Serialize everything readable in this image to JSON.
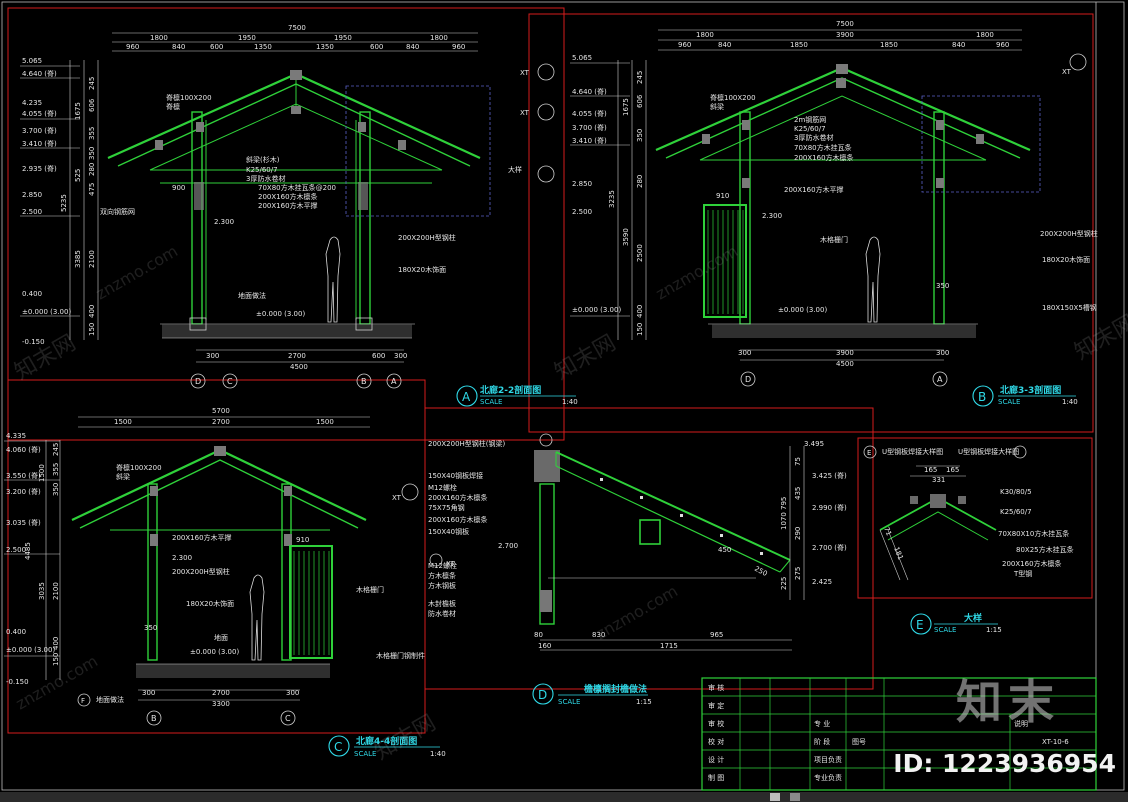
{
  "sections": {
    "a": {
      "letter": "A",
      "title": "北廊2-2剖面图",
      "scale_word": "SCALE",
      "scale": "1:40"
    },
    "b": {
      "letter": "B",
      "title": "北廊3-3剖面图",
      "scale_word": "SCALE",
      "scale": "1:40"
    },
    "c": {
      "letter": "C",
      "title": "北廊4-4剖面图",
      "scale_word": "SCALE",
      "scale": "1:40"
    },
    "d": {
      "letter": "D",
      "title": "檐檩搁封檐做法",
      "scale_word": "SCALE",
      "scale": "1:15"
    },
    "e": {
      "letter": "E",
      "title": "大样",
      "scale_word": "SCALE",
      "scale": "1:15"
    }
  },
  "a_dims": {
    "total": "7500",
    "top1": [
      "1800",
      "1950",
      "1950",
      "1800"
    ],
    "top2": [
      "960",
      "840",
      "600",
      "1350",
      "1350",
      "600",
      "840",
      "960"
    ],
    "bottom1": [
      "300",
      "2700",
      "600",
      "300"
    ],
    "bottom_total": "4500",
    "axes": [
      "D",
      "C",
      "B",
      "A"
    ],
    "elev": [
      "5.065",
      "4.640 (脊)",
      "4.235",
      "4.055 (脊)",
      "3.700 (脊)",
      "3.410 (脊)",
      "2.935 (脊)",
      "2.850",
      "2.500",
      "0.400",
      "±0.000 (3.00)",
      "-0.150"
    ],
    "left_dims": [
      "245",
      "606",
      "1675",
      "355",
      "350",
      "280",
      "475",
      "525",
      "3385",
      "2100",
      "400",
      "150",
      "5235"
    ],
    "notes": [
      "脊檩100X200",
      "脊檩",
      "斜梁(杉木)",
      "方木",
      "K25/60/7",
      "3厚防水卷材",
      "70X80方木挂瓦条@200",
      "200X160方木檩条",
      "200X160方木平撑",
      "双向钢筋网",
      "200X200H型钢柱",
      "180X20木饰面",
      "±0.000 (3.00)",
      "地面做法"
    ],
    "small": [
      "900",
      "2.300",
      "大样",
      "XT"
    ]
  },
  "b_dims": {
    "total": "7500",
    "top1": [
      "1800",
      "3900",
      "1800"
    ],
    "top2": [
      "960",
      "840",
      "1850",
      "1850",
      "840",
      "960"
    ],
    "bottom1": [
      "300",
      "3900",
      "300"
    ],
    "bottom_total": "4500",
    "axes": [
      "D",
      "A"
    ],
    "elev": [
      "5.065",
      "4.640 (脊)",
      "4.055 (脊)",
      "3.700 (脊)",
      "3.410 (脊)",
      "2.850",
      "2.500",
      "±0.000 (3.00)"
    ],
    "left_dims": [
      "245",
      "606",
      "1675",
      "350",
      "280",
      "3235",
      "3590",
      "2500",
      "400",
      "150"
    ],
    "notes": [
      "脊檩100X200",
      "斜梁",
      "2m钢筋网",
      "K25/60/7",
      "3厚防水卷材",
      "70X80方木挂瓦条",
      "200X160方木檩条",
      "200X160方木平撑",
      "200X200H型钢柱",
      "180X20木饰面",
      "木格栅门",
      "910",
      "2.300",
      "350",
      "180X150X5槽钢",
      "±0.000 (3.00)"
    ],
    "small": [
      "XT",
      "XT"
    ]
  },
  "c_dims": {
    "total": "5700",
    "top1": [
      "1500",
      "2700",
      "1500"
    ],
    "bottom1": [
      "300",
      "2700",
      "300"
    ],
    "bottom_total": "3300",
    "axes": [
      "B",
      "C"
    ],
    "elev": [
      "4.335",
      "4.060 (脊)",
      "3.550 (脊)",
      "3.200 (脊)",
      "3.035 (脊)",
      "2.500",
      "0.400",
      "±0.000 (3.00)",
      "-0.150"
    ],
    "left_dims": [
      "245",
      "355",
      "350",
      "1500",
      "4485",
      "3035",
      "2100",
      "400",
      "150"
    ],
    "notes": [
      "脊檩100X200",
      "斜梁",
      "200X160方木平撑",
      "2.300",
      "200X200H型钢柱",
      "180X20木饰面",
      "木格栅门",
      "910",
      "350",
      "地面",
      "±0.000 (3.00)",
      "木格栅门钢制件",
      "地面做法"
    ],
    "small": [
      "XT",
      "F"
    ]
  },
  "d_dims": {
    "notes": [
      "200X200H型钢柱(钢梁)",
      "150X40钢板焊接",
      "M12螺栓",
      "200X160方木檩条",
      "75X75角钢",
      "200X160方木檩条",
      "150X40钢板",
      "M12螺栓",
      "方木檩条",
      "方木钢板",
      "木封檐板",
      "防水卷材",
      "XT",
      "2.700"
    ],
    "right": [
      "3.495",
      "3.425 (脊)",
      "2.990 (脊)",
      "2.700 (脊)",
      "2.425"
    ],
    "right_dims": [
      "75",
      "435",
      "795",
      "1070",
      "290",
      "275",
      "225"
    ],
    "bottom": [
      "80",
      "830",
      "965",
      "160",
      "1715"
    ],
    "small": [
      "450",
      "250",
      "XT"
    ]
  },
  "e_dims": {
    "heading": "U型钢板焊接大样图",
    "labels": [
      "K30/80/5",
      "K25/60/7",
      "70X80X10方木挂瓦条",
      "80X25方木挂瓦条",
      "200X160方木檩条",
      "T型钢"
    ],
    "nums": [
      "165",
      "165",
      "331",
      "71",
      "181"
    ],
    "marker": "E"
  },
  "title_block": {
    "rows": [
      "审  核",
      "审  定",
      "审  校",
      "校  对",
      "设  计",
      "制  图"
    ],
    "cells": [
      "专  业",
      "阶  段",
      "图号",
      "项目负责",
      "专业负责"
    ],
    "sheet": "XT-10-6",
    "doc": "说明"
  },
  "watermark": {
    "logo": "知末",
    "id": "ID: 1223936954",
    "site": "znzmo.com",
    "text": "知末网"
  }
}
